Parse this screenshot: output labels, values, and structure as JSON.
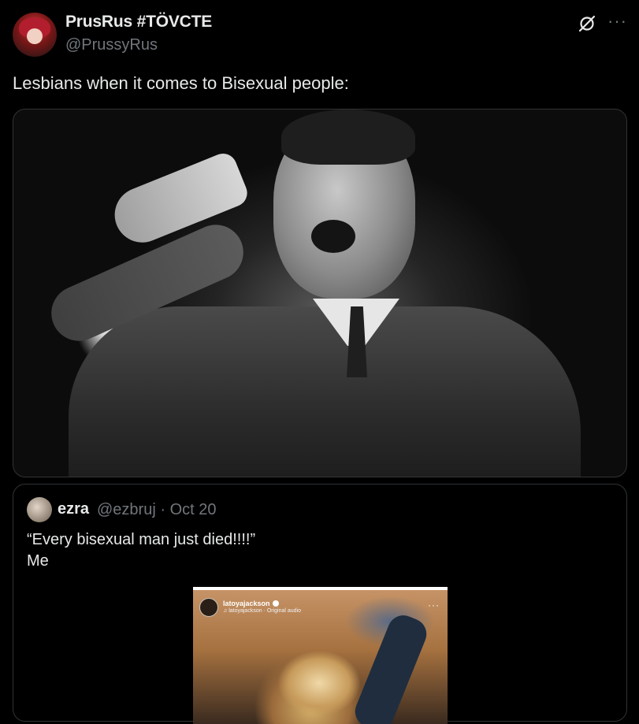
{
  "tweet": {
    "display_name": "PrusRus #TÖVCTE",
    "handle": "@PrussyRus",
    "text": "Lesbians when it comes to Bisexual people:",
    "more_label": "···"
  },
  "quote": {
    "name": "ezra",
    "handle": "@ezbruj",
    "separator": "·",
    "date": "Oct 20",
    "text_line1": "“Every bisexual man just died!!!!”",
    "text_line2": "Me"
  },
  "video": {
    "username": "latoyajackson",
    "audio": "♫ latoyajackson · Original audio",
    "more_label": "···"
  },
  "colors": {
    "background": "#000000",
    "text": "#e7e9ea",
    "secondary": "#71767b",
    "border": "#2f3336"
  },
  "icons": [
    "grok-icon",
    "more-icon"
  ]
}
